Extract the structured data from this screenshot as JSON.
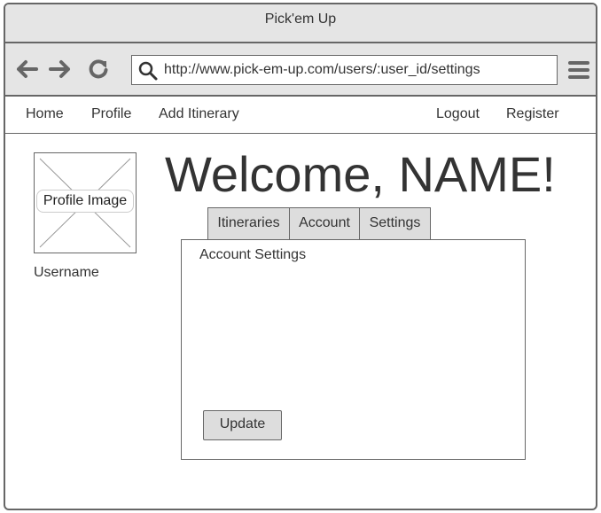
{
  "window": {
    "title": "Pick'em Up"
  },
  "toolbar": {
    "back_icon": "arrow-left-icon",
    "forward_icon": "arrow-right-icon",
    "reload_icon": "reload-icon",
    "search_icon": "search-icon",
    "url": "http://www.pick-em-up.com/users/:user_id/settings",
    "menu_icon": "hamburger-menu-icon"
  },
  "nav": {
    "home": "Home",
    "profile": "Profile",
    "add_itinerary": "Add Itinerary",
    "logout": "Logout",
    "register": "Register"
  },
  "profile": {
    "image_label": "Profile Image",
    "username": "Username"
  },
  "main": {
    "welcome": "Welcome, NAME!",
    "tabs": [
      {
        "label": "Itineraries"
      },
      {
        "label": "Account"
      },
      {
        "label": "Settings"
      }
    ],
    "panel_title": "Account Settings",
    "update_label": "Update"
  },
  "colors": {
    "chrome": "#e5e5e5",
    "border": "#666666",
    "text": "#333333",
    "tab_bg": "#dddddd"
  }
}
